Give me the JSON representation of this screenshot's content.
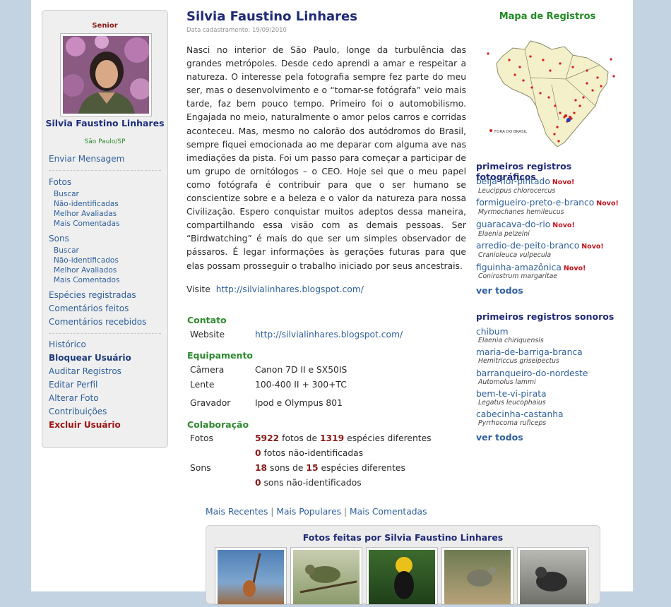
{
  "profile": {
    "level": "Senior",
    "name": "Silvia Faustino Linhares",
    "location": "São Paulo/SP",
    "registered": "Data cadastramento: 19/09/2010"
  },
  "sidebar": {
    "send_message": "Enviar Mensagem",
    "photos": "Fotos",
    "photos_sub": [
      "Buscar",
      "Não-identificadas",
      "Melhor Avaliadas",
      "Mais Comentadas"
    ],
    "sounds": "Sons",
    "sounds_sub": [
      "Buscar",
      "Não-identificados",
      "Melhor Avaliados",
      "Mais Comentados"
    ],
    "species": "Espécies registradas",
    "comments_made": "Comentários feitos",
    "comments_received": "Comentários recebidos",
    "history": "Histórico",
    "block_user": "Bloquear Usuário",
    "audit": "Auditar Registros",
    "edit_profile": "Editar Perfil",
    "change_photo": "Alterar Foto",
    "contributions": "Contribuições",
    "delete_user": "Excluir Usuário"
  },
  "bio": "Nasci no interior de São Paulo, longe da turbulência das grandes metrópoles. Desde cedo aprendi a amar e respeitar a natureza. O interesse pela fotografia sempre fez parte do meu ser, mas o desenvolvimento e o “tornar-se fotógrafa” veio mais tarde, faz bem pouco tempo. Primeiro foi o automobilismo. Engajada no meio, naturalmente o amor pelos carros e corridas aconteceu. Mas, mesmo no calorão dos autódromos do Brasil, sempre fiquei emocionada ao me deparar com alguma ave nas imediações da pista. Foi um passo para começar a participar de um grupo de ornitólogos – o CEO. Hoje sei que o meu papel como fotógrafa é contribuir para que o ser humano se conscientize sobre e a beleza e o valor da natureza para nossa Civilização. Espero conquistar muitos adeptos dessa maneira, compartilhando essa visão com as demais pessoas. Ser “Birdwatching” é mais do que ser um simples observador de pássaros. É legar informações às gerações futuras para que elas possam prosseguir o trabalho iniciado por seus ancestrais.",
  "visit": {
    "label": "Visite",
    "url": "http://silvialinhares.blogspot.com/"
  },
  "contact": {
    "heading": "Contato",
    "website_label": "Website",
    "website": "http://silvialinhares.blogspot.com/"
  },
  "equipment": {
    "heading": "Equipamento",
    "camera_label": "Câmera",
    "camera": "Canon 7D II e SX50IS",
    "lens_label": "Lente",
    "lens": "100-400 II + 300+TC",
    "recorder_label": "Gravador",
    "recorder": "Ipod e Olympus 801"
  },
  "collab": {
    "heading": "Colaboração",
    "photos_label": "Fotos",
    "photos_count": "5922",
    "photos_mid": "fotos de",
    "photos_species": "1319",
    "photos_end": "espécies diferentes",
    "photos_unid": "0",
    "photos_unid_text": "fotos não-identificadas",
    "sounds_label": "Sons",
    "sounds_count": "18",
    "sounds_mid": "sons de",
    "sounds_species": "15",
    "sounds_end": "espécies diferentes",
    "sounds_unid": "0",
    "sounds_unid_text": "sons não-identificados"
  },
  "tabs": [
    "Mais Recentes",
    "Mais Populares",
    "Mais Comentadas"
  ],
  "tab_separator": "|",
  "photos_box_title": "Fotos feitas por Silvia Faustino Linhares",
  "map": {
    "title": "Mapa de Registros",
    "legend": "FORA DO BRASIL"
  },
  "first_photos": {
    "heading": "primeiros registros fotográficos",
    "new_label": "Novo!",
    "items": [
      {
        "common": "beija-flor-pintado",
        "sci": "Leucippus chlorocercus"
      },
      {
        "common": "formigueiro-preto-e-branco",
        "sci": "Myrmochanes hemileucus"
      },
      {
        "common": "guaracava-do-rio",
        "sci": "Elaenia pelzelni"
      },
      {
        "common": "arredio-de-peito-branco",
        "sci": "Cranioleuca vulpecula"
      },
      {
        "common": "figuinha-amazônica",
        "sci": "Conirostrum margaritae"
      }
    ],
    "see_all": "ver todos"
  },
  "first_sounds": {
    "heading": "primeiros registros sonoros",
    "items": [
      {
        "common": "chibum",
        "sci": "Elaenia chiriquensis"
      },
      {
        "common": "maria-de-barriga-branca",
        "sci": "Hemitriccus griseipectus"
      },
      {
        "common": "barranqueiro-do-nordeste",
        "sci": "Automolus lammi"
      },
      {
        "common": "bem-te-vi-pirata",
        "sci": "Legatus leucophaius"
      },
      {
        "common": "cabecinha-castanha",
        "sci": "Pyrrhocoma ruficeps"
      }
    ],
    "see_all": "ver todos"
  },
  "colors": {
    "title": "#1f2a78",
    "link": "#2d5f9e",
    "green": "#2e8b2e",
    "red": "#c1121f",
    "background": "#c3d3e2"
  }
}
